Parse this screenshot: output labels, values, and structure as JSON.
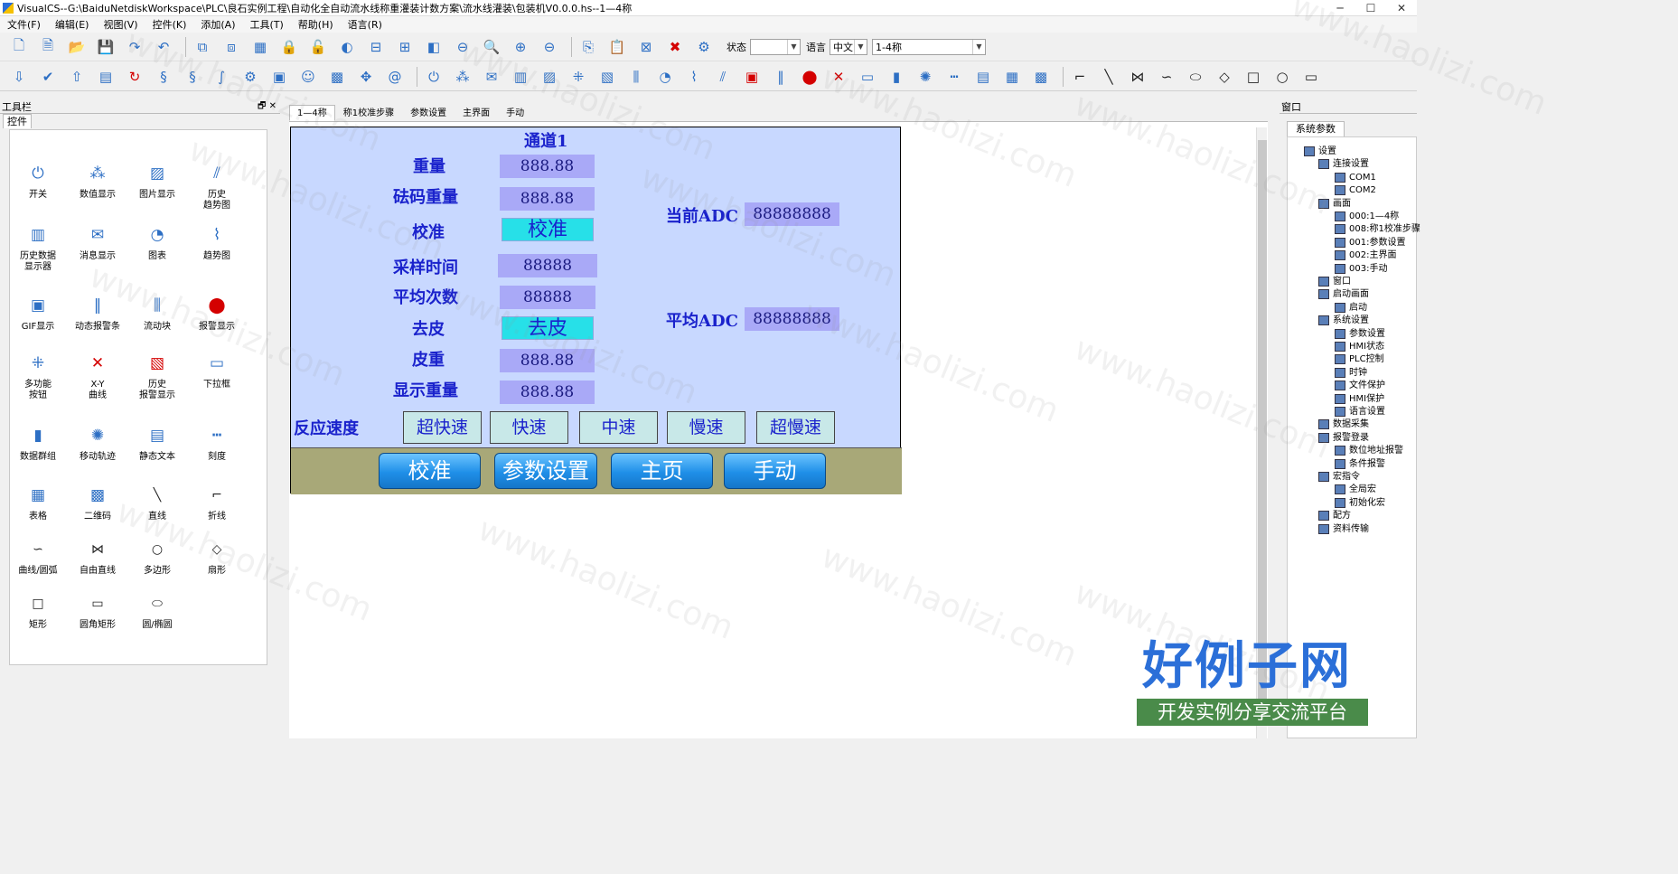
{
  "window": {
    "title": "VisualCS--G:\\BaiduNetdiskWorkspace\\PLC\\良石实例工程\\自动化全自动流水线称重灌装计数方案\\流水线灌装\\包装机V0.0.0.hs--1—4称"
  },
  "menu": [
    "文件(F)",
    "编辑(E)",
    "视图(V)",
    "控件(K)",
    "添加(A)",
    "工具(T)",
    "帮助(H)",
    "语言(R)"
  ],
  "toolbar1": {
    "state_label": "状态",
    "state_value": "",
    "lang_label": "语言",
    "lang_value": "中文",
    "screen_value": "1-4称"
  },
  "toolbox": {
    "header": "工具栏",
    "tab": "控件",
    "items": [
      {
        "label": "开关",
        "icon": "power-icon"
      },
      {
        "label": "数值显示",
        "icon": "numeric-icon"
      },
      {
        "label": "图片显示",
        "icon": "picture-icon"
      },
      {
        "label": "历史\n趋势图",
        "icon": "history-trend-icon"
      },
      {
        "label": "历史数据\n显示器",
        "icon": "history-data-icon"
      },
      {
        "label": "消息显示",
        "icon": "message-icon"
      },
      {
        "label": "图表",
        "icon": "gauge-icon"
      },
      {
        "label": "趋势图",
        "icon": "trend-icon"
      },
      {
        "label": "GIF显示",
        "icon": "gif-icon"
      },
      {
        "label": "动态报警条",
        "icon": "alarm-bar-icon"
      },
      {
        "label": "流动块",
        "icon": "flow-block-icon"
      },
      {
        "label": "报警显示",
        "icon": "alarm-icon"
      },
      {
        "label": "多功能\n按钮",
        "icon": "multi-button-icon"
      },
      {
        "label": "X-Y\n曲线",
        "icon": "xy-curve-icon"
      },
      {
        "label": "历史\n报警显示",
        "icon": "history-alarm-icon"
      },
      {
        "label": "下拉框",
        "icon": "dropdown-icon"
      },
      {
        "label": "数据群组",
        "icon": "data-group-icon"
      },
      {
        "label": "移动轨迹",
        "icon": "track-icon"
      },
      {
        "label": "静态文本",
        "icon": "static-text-icon"
      },
      {
        "label": "刻度",
        "icon": "scale-icon"
      },
      {
        "label": "表格",
        "icon": "table-icon"
      },
      {
        "label": "二维码",
        "icon": "qrcode-icon"
      },
      {
        "label": "直线",
        "icon": "line-icon"
      },
      {
        "label": "折线",
        "icon": "polyline-icon"
      },
      {
        "label": "曲线/圆弧",
        "icon": "curve-icon"
      },
      {
        "label": "自由直线",
        "icon": "free-line-icon"
      },
      {
        "label": "多边形",
        "icon": "polygon-icon"
      },
      {
        "label": "扇形",
        "icon": "sector-icon"
      },
      {
        "label": "矩形",
        "icon": "rect-icon"
      },
      {
        "label": "圆角矩形",
        "icon": "round-rect-icon"
      },
      {
        "label": "圆/椭圆",
        "icon": "ellipse-icon"
      }
    ]
  },
  "tabs": [
    "1—4称",
    "称1校准步骤",
    "参数设置",
    "主界面",
    "手动"
  ],
  "hmi": {
    "channel_title": "通道1",
    "weight_label": "重量",
    "weight_value": "888.88",
    "cal_weight_label": "砝码重量",
    "cal_weight_value": "888.88",
    "calibrate_label": "校准",
    "calibrate_button": "校准",
    "sample_time_label": "采样时间",
    "sample_time_value": "88888",
    "avg_count_label": "平均次数",
    "avg_count_value": "88888",
    "tare_label": "去皮",
    "tare_button": "去皮",
    "tare_weight_label": "皮重",
    "tare_weight_value": "888.88",
    "display_weight_label": "显示重量",
    "display_weight_value": "888.88",
    "current_adc_label": "当前ADC",
    "current_adc_value": "88888888",
    "avg_adc_label": "平均ADC",
    "avg_adc_value": "88888888",
    "speed_label": "反应速度",
    "speeds": [
      "超快速",
      "快速",
      "中速",
      "慢速",
      "超慢速"
    ],
    "nav": [
      "校准",
      "参数设置",
      "主页",
      "手动"
    ]
  },
  "window_panel": {
    "header": "窗口",
    "tab": "系统参数",
    "tree": [
      {
        "label": "设置",
        "level": 0
      },
      {
        "label": "连接设置",
        "level": 1
      },
      {
        "label": "COM1",
        "level": 2
      },
      {
        "label": "COM2",
        "level": 2
      },
      {
        "label": "画面",
        "level": 1
      },
      {
        "label": "000:1—4称",
        "level": 2
      },
      {
        "label": "008:称1校准步骤",
        "level": 2
      },
      {
        "label": "001:参数设置",
        "level": 2
      },
      {
        "label": "002:主界面",
        "level": 2
      },
      {
        "label": "003:手动",
        "level": 2
      },
      {
        "label": "窗口",
        "level": 1
      },
      {
        "label": "启动画面",
        "level": 1
      },
      {
        "label": "启动",
        "level": 2
      },
      {
        "label": "系统设置",
        "level": 1
      },
      {
        "label": "参数设置",
        "level": 2
      },
      {
        "label": "HMI状态",
        "level": 2
      },
      {
        "label": "PLC控制",
        "level": 2
      },
      {
        "label": "时钟",
        "level": 2
      },
      {
        "label": "文件保护",
        "level": 2
      },
      {
        "label": "HMI保护",
        "level": 2
      },
      {
        "label": "语言设置",
        "level": 2
      },
      {
        "label": "数据采集",
        "level": 1
      },
      {
        "label": "报警登录",
        "level": 1
      },
      {
        "label": "数位地址报警",
        "level": 2
      },
      {
        "label": "条件报警",
        "level": 2
      },
      {
        "label": "宏指令",
        "level": 1
      },
      {
        "label": "全局宏",
        "level": 2
      },
      {
        "label": "初始化宏",
        "level": 2
      },
      {
        "label": "配方",
        "level": 1
      },
      {
        "label": "资料传输",
        "level": 1
      }
    ]
  },
  "watermark": {
    "text": "www.haolizi.com",
    "brand": "好例子网",
    "slogan": "开发实例分享交流平台"
  }
}
